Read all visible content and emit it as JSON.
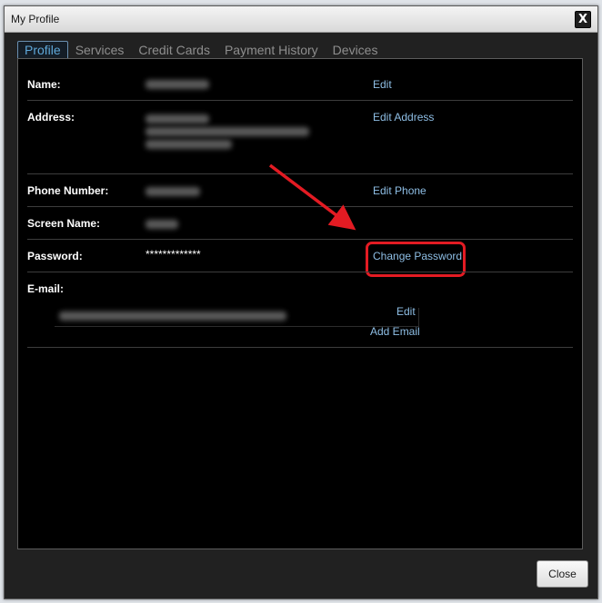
{
  "window": {
    "title": "My Profile",
    "close_glyph": "X"
  },
  "tabs": [
    {
      "label": "Profile"
    },
    {
      "label": "Services"
    },
    {
      "label": "Credit Cards"
    },
    {
      "label": "Payment History"
    },
    {
      "label": "Devices"
    }
  ],
  "profile": {
    "name_label": "Name:",
    "name_edit": "Edit",
    "address_label": "Address:",
    "address_edit": "Edit Address",
    "phone_label": "Phone Number:",
    "phone_edit": "Edit Phone",
    "screen_name_label": "Screen Name:",
    "password_label": "Password:",
    "password_value": "*************",
    "password_change": "Change Password",
    "email_label": "E-mail:",
    "email_edit": "Edit",
    "email_add": "Add Email"
  },
  "footer": {
    "close_label": "Close"
  },
  "colors": {
    "link": "#8fbfe6",
    "highlight": "#e31b23",
    "active_tab": "#5fa8d8"
  }
}
